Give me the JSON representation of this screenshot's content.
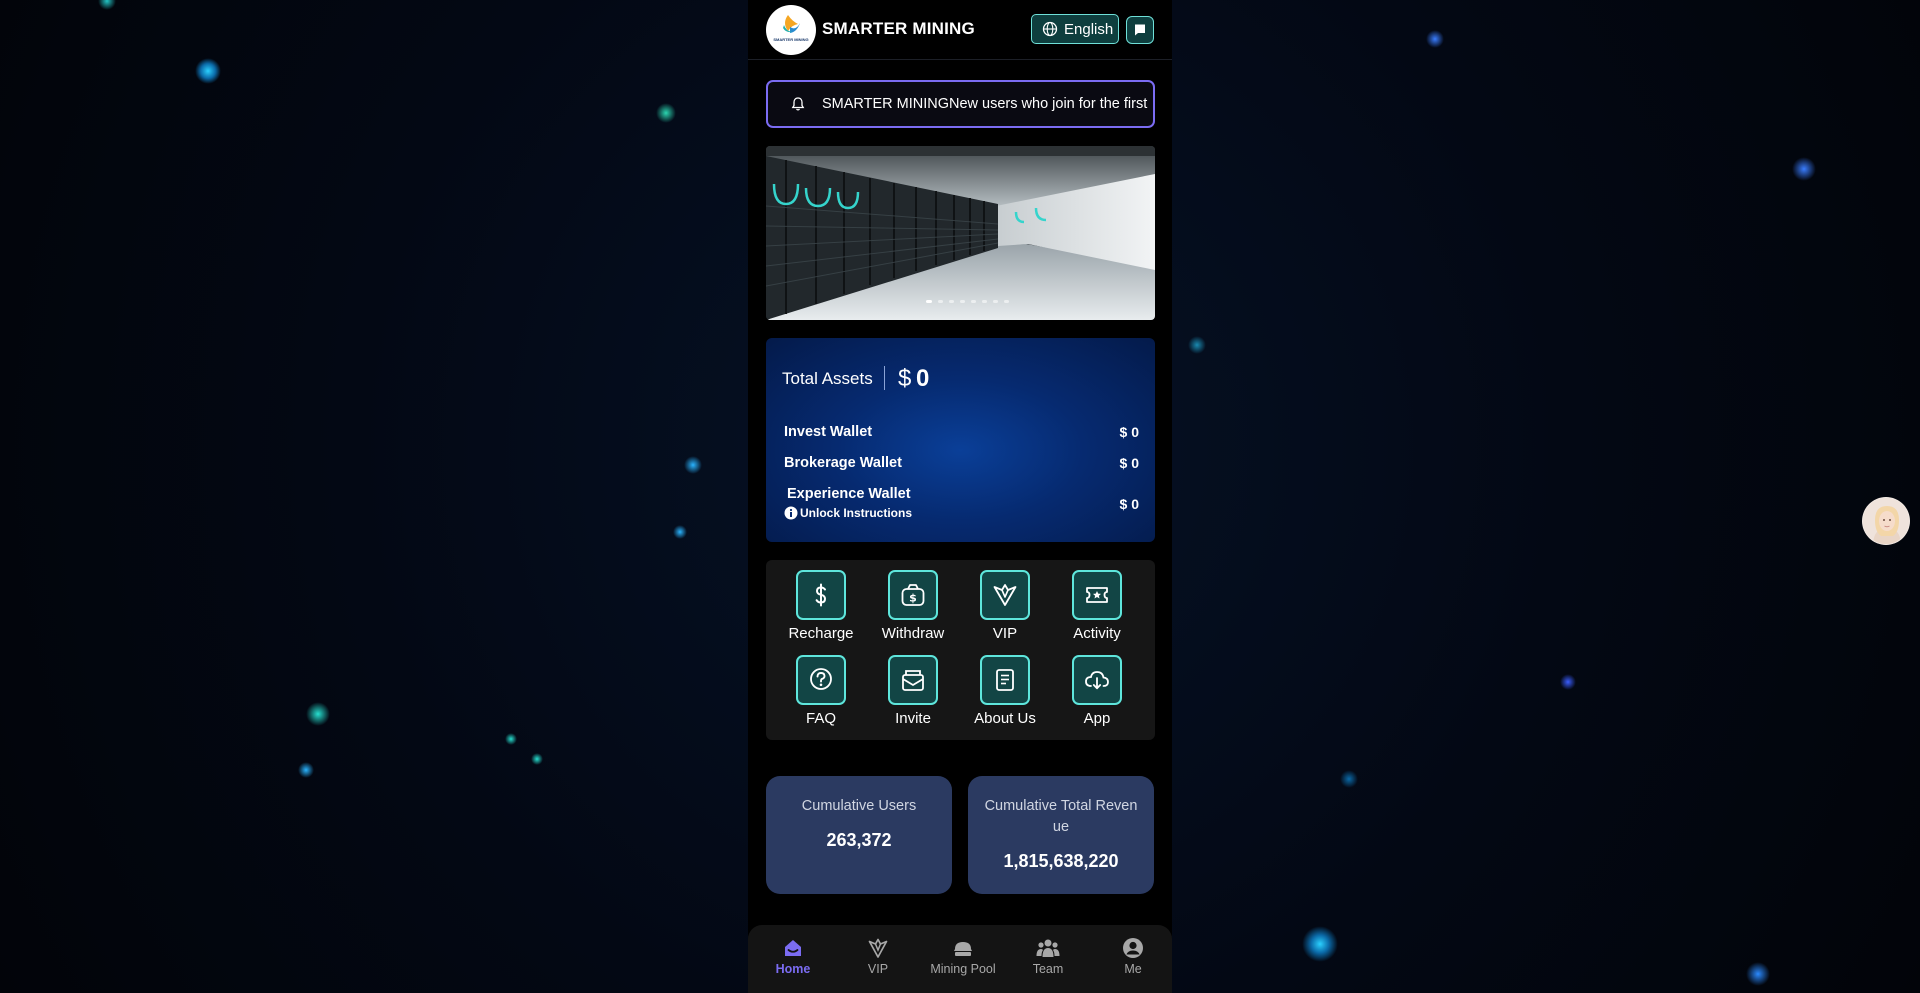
{
  "header": {
    "brand": "SMARTER MINING",
    "logo_text": "SMARTER MINING",
    "language_label": "English",
    "language_icon": "globe-icon",
    "message_icon": "chat-icon"
  },
  "notice": {
    "icon": "bell-icon",
    "text": "SMARTER MININGNew users who join for the first"
  },
  "banner": {
    "slide_count": 8,
    "active_slide": 1
  },
  "assets": {
    "label": "Total Assets",
    "currency": "$",
    "value": "0",
    "wallets": [
      {
        "name": "Invest Wallet",
        "value": "$ 0"
      },
      {
        "name": "Brokerage Wallet",
        "value": "$ 0"
      },
      {
        "name": "Experience Wallet",
        "value": "$ 0"
      }
    ],
    "unlock_label": "Unlock Instructions",
    "info_icon": "info-icon"
  },
  "actions": [
    {
      "label": "Recharge",
      "icon": "dollar-icon"
    },
    {
      "label": "Withdraw",
      "icon": "money-bag-icon"
    },
    {
      "label": "VIP",
      "icon": "diamond-icon"
    },
    {
      "label": "Activity",
      "icon": "ticket-icon"
    },
    {
      "label": "FAQ",
      "icon": "question-icon"
    },
    {
      "label": "Invite",
      "icon": "envelope-icon"
    },
    {
      "label": "About Us",
      "icon": "document-icon"
    },
    {
      "label": "App",
      "icon": "cloud-download-icon"
    }
  ],
  "stats": [
    {
      "label": "Cumulative Users",
      "value": "263,372"
    },
    {
      "label": "Cumulative Total Reven ue",
      "value": "1,815,638,220"
    }
  ],
  "nav": [
    {
      "label": "Home",
      "icon": "home-icon",
      "active": true
    },
    {
      "label": "VIP",
      "icon": "diamond-icon",
      "active": false
    },
    {
      "label": "Mining Pool",
      "icon": "mining-pool-icon",
      "active": false
    },
    {
      "label": "Team",
      "icon": "team-icon",
      "active": false
    },
    {
      "label": "Me",
      "icon": "user-icon",
      "active": false
    }
  ],
  "colors": {
    "accent": "#7b6cf2",
    "teal": "#5ee6dc",
    "card_blue": "#062a70",
    "stat_bg": "#2b3a61"
  },
  "support": {
    "icon": "support-avatar-icon"
  }
}
